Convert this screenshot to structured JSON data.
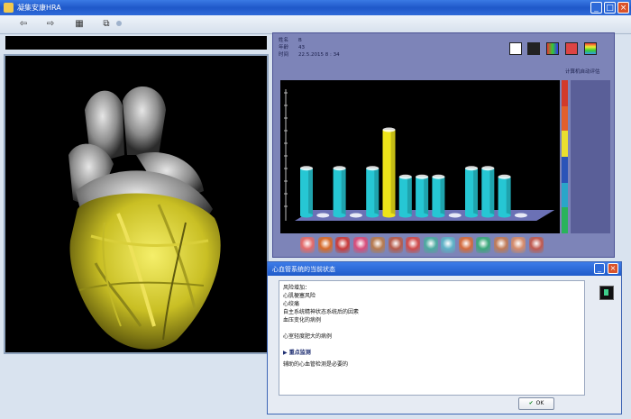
{
  "window": {
    "title": "凝集安康HRA",
    "buttons": {
      "minimize": "_",
      "maximize": "□",
      "close": "×"
    }
  },
  "toolbar": {
    "back_icon": "⇦",
    "forward_icon": "⇨",
    "doc_icon": "▦",
    "copy_icon": "⧉"
  },
  "patient": {
    "rows": [
      {
        "label": "姓名",
        "value": "B"
      },
      {
        "label": "年龄",
        "value": "43"
      },
      {
        "label": "时间",
        "value": "22.5.2015  8 : 34"
      }
    ]
  },
  "right_caption": "计算机自动评估",
  "chart_data": {
    "type": "bar",
    "values": [
      55,
      0,
      55,
      0,
      55,
      100,
      45,
      45,
      45,
      0,
      55,
      55,
      45,
      0
    ],
    "highlight_index": 5,
    "colors": {
      "normal": "#26c7d4",
      "highlight": "#eee41a",
      "zero": "#e6e9f6"
    }
  },
  "scale_colors": [
    "#d23a2b",
    "#e25f2c",
    "#eadf2f",
    "#2b54b8",
    "#2aa6c9",
    "#2ab35b"
  ],
  "organ_icons": [
    "#e46a6a",
    "#d66a2a",
    "#c93b3b",
    "#d84c7a",
    "#b77a4e",
    "#b65a4a",
    "#d04a4a",
    "#4caaa0",
    "#5db2c7",
    "#d46a3c",
    "#3aa87a",
    "#c07a56",
    "#d68b6a",
    "#c05a50"
  ],
  "dialog": {
    "title": "心血管系统的当前状态",
    "lines": [
      "风险增加：",
      "心肌梗塞风险",
      "心绞痛",
      "自主系统精神状态系统后的因素",
      "血压变化的病例"
    ],
    "note": "心室轻度肥大的病例",
    "section_title": "▶ 重点监测",
    "section_text": "辅助的心血管检测是必要的",
    "ok_label": "OK"
  }
}
